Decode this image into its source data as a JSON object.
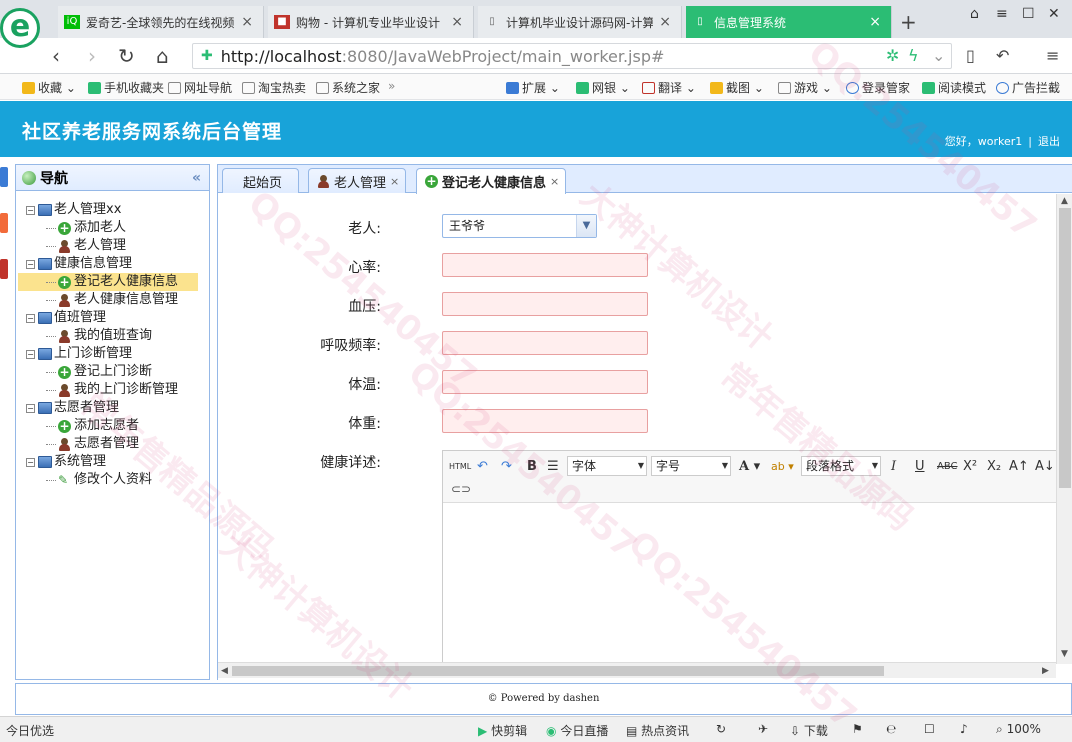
{
  "browser": {
    "tabs": [
      {
        "title": "爱奇艺-全球领先的在线视频",
        "favicon": "iqiyi-icon"
      },
      {
        "title": "购物 - 计算机专业毕业设计",
        "favicon": "shop-icon"
      },
      {
        "title": "计算机毕业设计源码网-计算",
        "favicon": "page-icon"
      },
      {
        "title": "信息管理系统",
        "favicon": "page-icon",
        "active": true
      }
    ],
    "url_host": "http://localhost",
    "url_path": ":8080/JavaWebProject/main_worker.jsp#",
    "bookmarks": [
      "收藏",
      "手机收藏夹",
      "网址导航",
      "淘宝热卖",
      "系统之家"
    ],
    "tools": [
      "扩展",
      "网银",
      "翻译",
      "截图",
      "游戏",
      "登录管家",
      "阅读模式",
      "广告拦截"
    ]
  },
  "app": {
    "title": "社区养老服务网系统后台管理",
    "greeting": "您好，worker1",
    "logout": "退出",
    "footer": "© Powered by dashen"
  },
  "sidebar": {
    "title": "导航",
    "groups": [
      {
        "label": "老人管理xx",
        "items": [
          {
            "label": "添加老人",
            "icon": "add-icon"
          },
          {
            "label": "老人管理",
            "icon": "person-icon"
          }
        ]
      },
      {
        "label": "健康信息管理",
        "items": [
          {
            "label": "登记老人健康信息",
            "icon": "add-icon",
            "selected": true
          },
          {
            "label": "老人健康信息管理",
            "icon": "person-icon"
          }
        ]
      },
      {
        "label": "值班管理",
        "items": [
          {
            "label": "我的值班查询",
            "icon": "person-icon"
          }
        ]
      },
      {
        "label": "上门诊断管理",
        "items": [
          {
            "label": "登记上门诊断",
            "icon": "add-icon"
          },
          {
            "label": "我的上门诊断管理",
            "icon": "person-icon"
          }
        ]
      },
      {
        "label": "志愿者管理",
        "items": [
          {
            "label": "添加志愿者",
            "icon": "add-icon"
          },
          {
            "label": "志愿者管理",
            "icon": "person-icon"
          }
        ]
      },
      {
        "label": "系统管理",
        "items": [
          {
            "label": "修改个人资料",
            "icon": "pencil-icon"
          }
        ]
      }
    ]
  },
  "content_tabs": [
    {
      "label": "起始页"
    },
    {
      "label": "老人管理"
    },
    {
      "label": "登记老人健康信息",
      "active": true
    }
  ],
  "form": {
    "elder_label": "老人:",
    "elder_value": "王爷爷",
    "heart_rate_label": "心率:",
    "blood_pressure_label": "血压:",
    "respiration_label": "呼吸频率:",
    "temperature_label": "体温:",
    "weight_label": "体重:",
    "detail_label": "健康详述:"
  },
  "editor": {
    "html_btn": "HTML",
    "font_family": "字体",
    "font_size": "字号",
    "paragraph": "段落格式"
  },
  "statusbar": {
    "left": "今日优选",
    "items": [
      "快剪辑",
      "今日直播",
      "热点资讯",
      "下载"
    ],
    "zoom": "100%"
  },
  "watermark": [
    "大神计算机设计",
    "QQ:254540457",
    "常年售精品源码"
  ],
  "colors": {
    "header": "#18a3d9",
    "active_browser_tab": "#2bbd74",
    "selected_nav": "#fbe38e"
  }
}
